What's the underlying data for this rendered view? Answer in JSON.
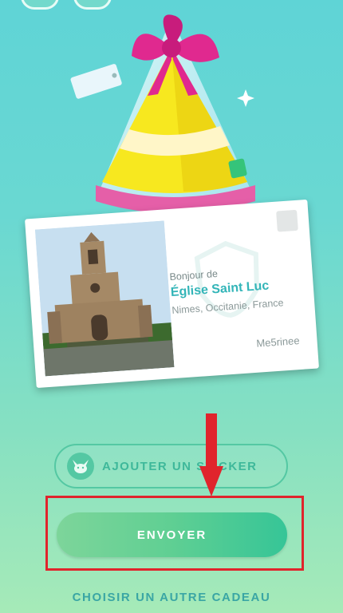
{
  "postcard": {
    "greeting": "Bonjour de",
    "place": "Église Saint Luc",
    "location": "Nimes, Occitanie, France",
    "sender": "Me5rinee"
  },
  "actions": {
    "sticker_label": "AJOUTER UN STICKER",
    "send_label": "ENVOYER",
    "other_gift_label": "CHOISIR UN AUTRE CADEAU"
  },
  "icons": {
    "sticker": "eevee-sticker-icon",
    "gift": "gift-box-icon",
    "arrow": "red-down-arrow-icon"
  },
  "colors": {
    "accent": "#3eb89a",
    "send_button": "#5fcf93",
    "highlight": "#e0242c",
    "gift_ribbon": "#e0298f",
    "gift_body": "#f7e81f"
  }
}
